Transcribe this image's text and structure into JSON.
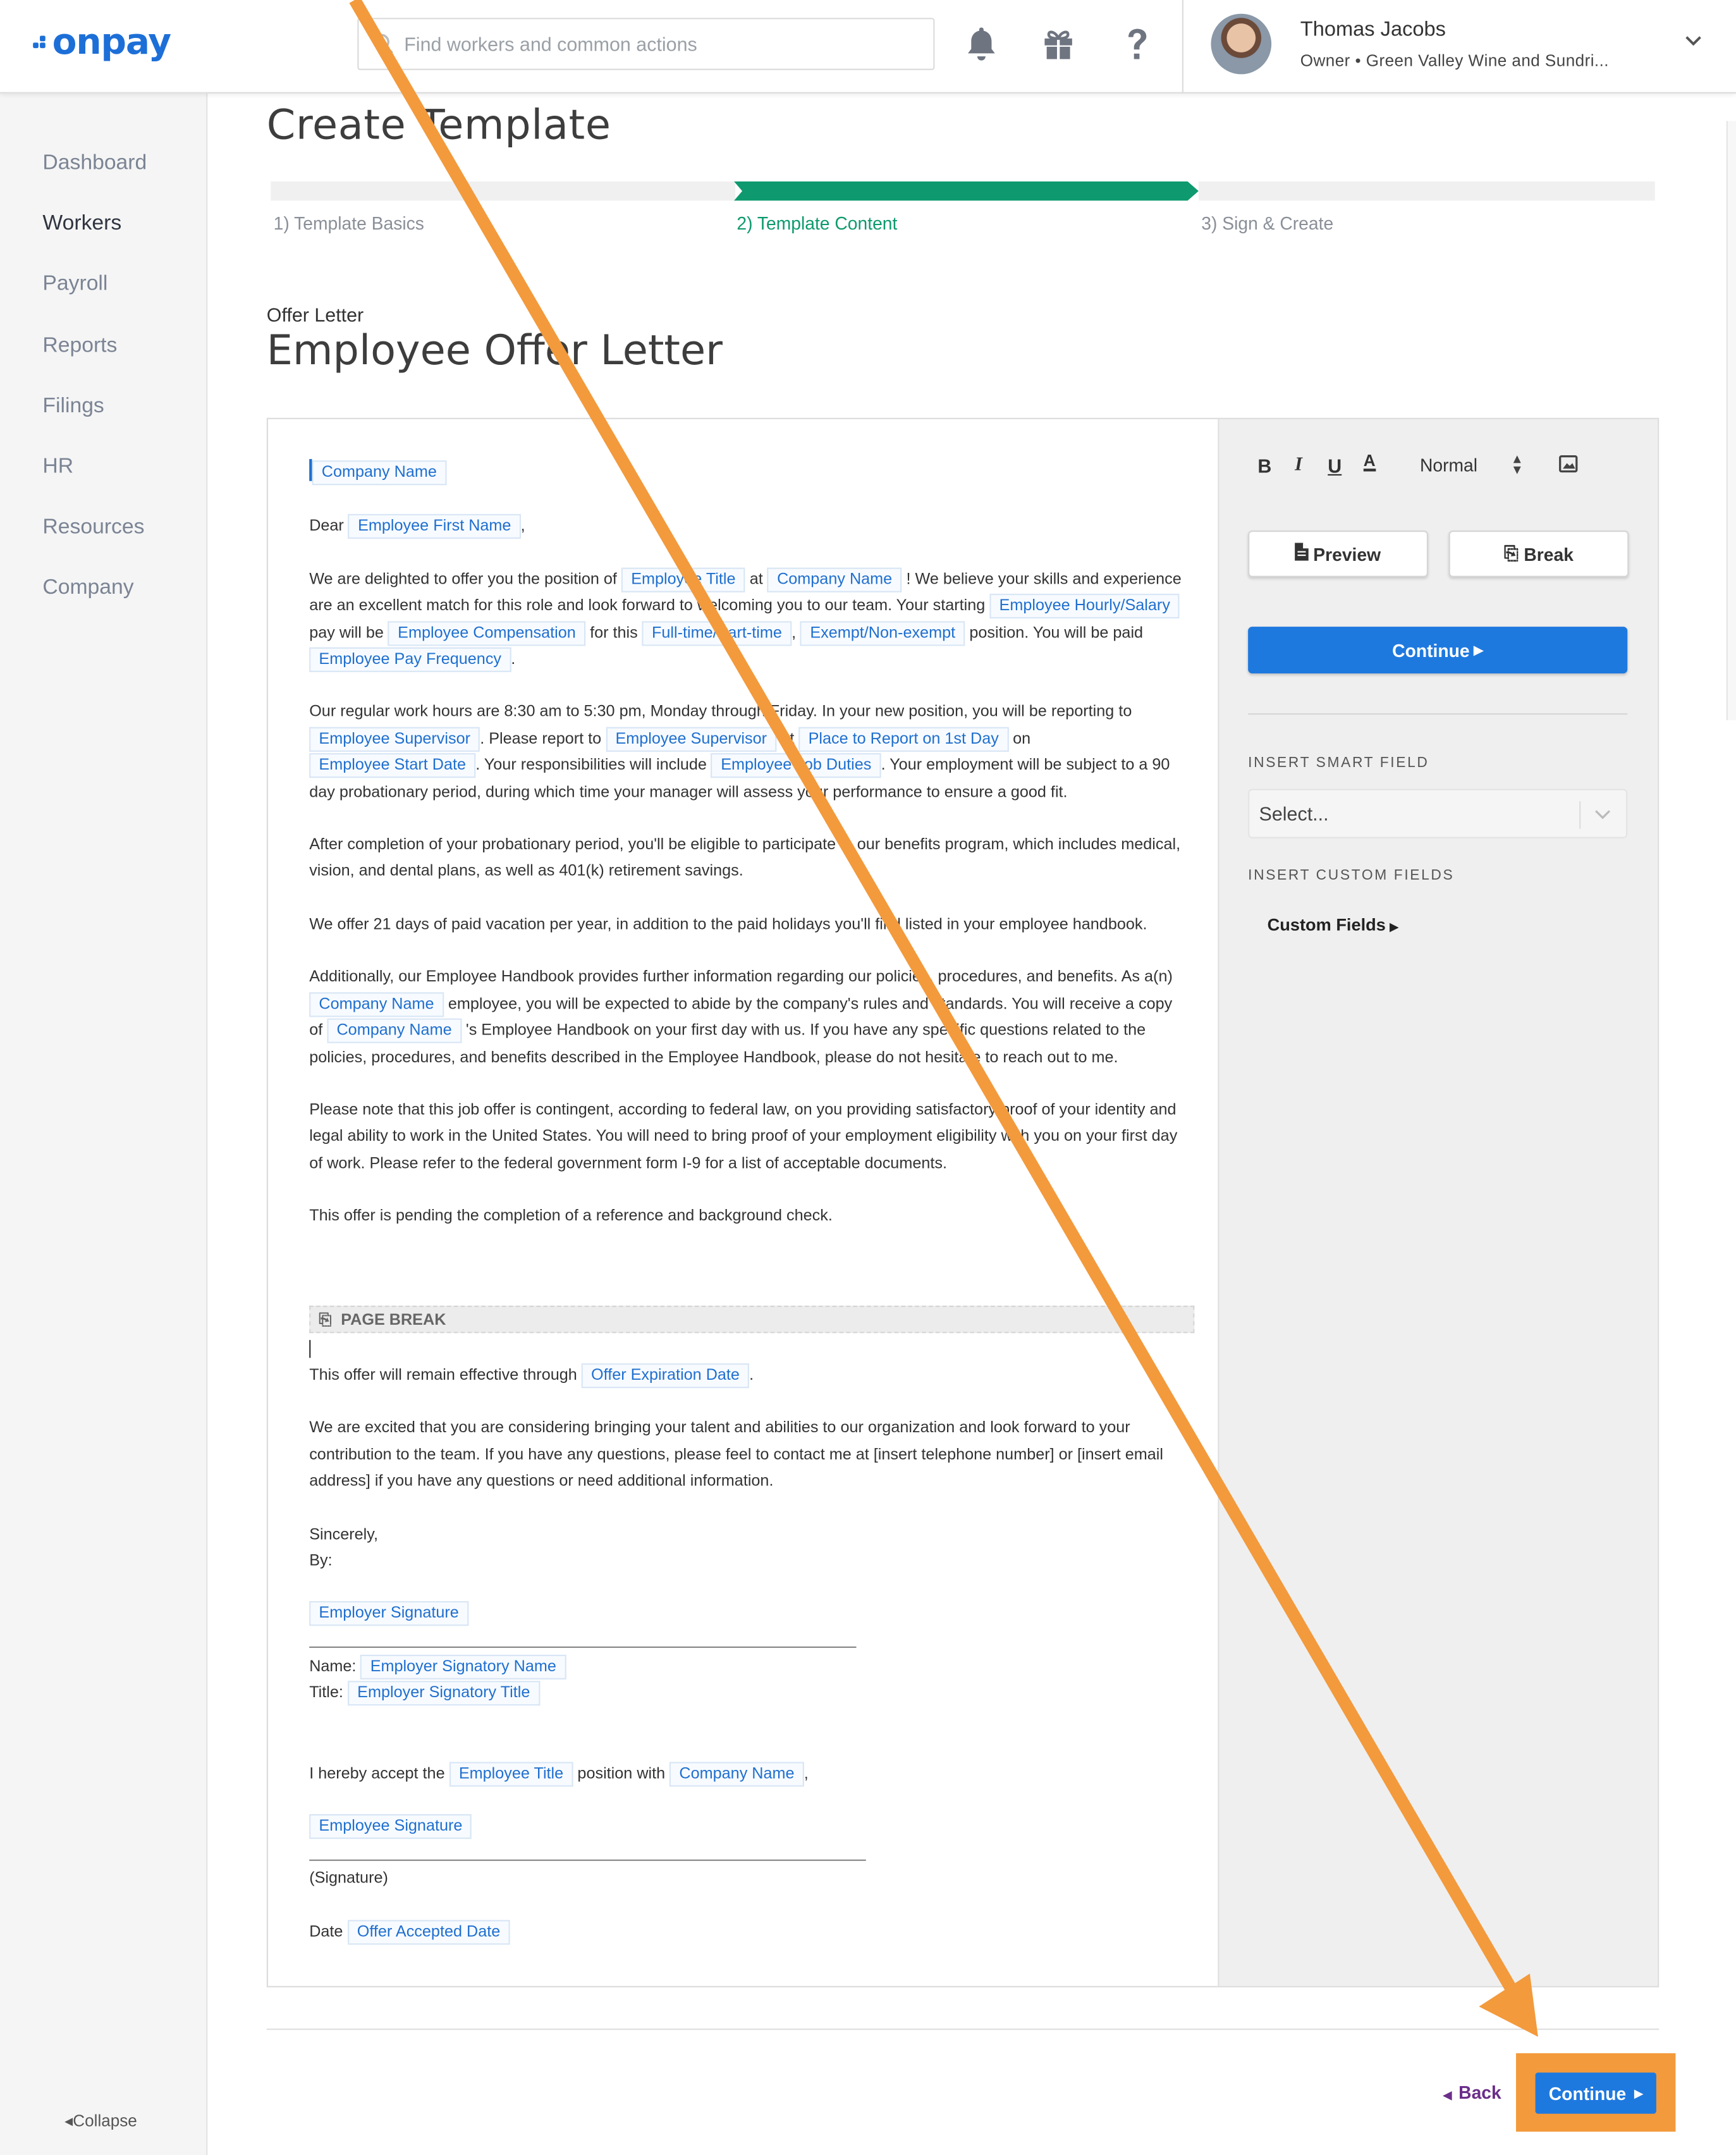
{
  "app": {
    "logo": "onpay",
    "brand_color": "#1d6fd8"
  },
  "header": {
    "search_placeholder": "Find workers and common actions",
    "user_name": "Thomas Jacobs",
    "user_role": "Owner • Green Valley Wine and Sundri..."
  },
  "sidebar": {
    "items": [
      {
        "label": "Dashboard"
      },
      {
        "label": "Workers"
      },
      {
        "label": "Payroll"
      },
      {
        "label": "Reports"
      },
      {
        "label": "Filings"
      },
      {
        "label": "HR"
      },
      {
        "label": "Resources"
      },
      {
        "label": "Company"
      }
    ],
    "collapse_label": "Collapse"
  },
  "page": {
    "title": "Create Template",
    "steps": [
      {
        "label": "1) Template Basics"
      },
      {
        "label": "2) Template Content"
      },
      {
        "label": "3) Sign & Create"
      }
    ],
    "active_step_color": "#0e9a6e",
    "doc_type": "Offer Letter",
    "doc_title": "Employee Offer Letter"
  },
  "doc": {
    "company_name": "Company Name",
    "dear": "Dear",
    "f_first_name": "Employee First Name",
    "p1_a": "We are delighted to offer you the position of",
    "f_title": "Employee Title",
    "at": "at",
    "p1_b": "! We believe your skills and experience are an excellent match for this role and look forward to welcoming you to our team. Your starting",
    "f_hourly": "Employee Hourly/Salary",
    "p1_c": "pay will be",
    "f_comp": "Employee Compensation",
    "for_this": "for this",
    "f_ftpt": "Full-time/Part-time",
    "f_exempt": "Exempt/Non-exempt",
    "p1_d": "position. You will be paid",
    "f_freq": "Employee Pay Frequency",
    "p2_a": "Our regular work hours are 8:30 am to 5:30 pm, Monday through Friday. In your new position, you will be reporting to",
    "f_supervisor": "Employee Supervisor",
    "p2_b": ". Please report to",
    "f_supervisor2": "Employee Supervisor",
    "p2_at": "at",
    "f_place": "Place to Report on 1st Day",
    "on": "on",
    "f_start": "Employee Start Date",
    "p2_c": ". Your responsibilities will include",
    "f_duties": "Employee Job Duties",
    "p2_d": ". Your employment will be subject to a 90 day probationary period, during which time your manager will assess your performance to ensure a good fit.",
    "p3": "After completion of your probationary period, you'll be eligible to participate in our benefits program, which includes medical, vision, and dental plans, as well as 401(k) retirement savings.",
    "p4": "We offer 21 days of paid vacation per year, in addition to the paid holidays you'll find listed in your employee handbook.",
    "p5_a": "Additionally, our Employee Handbook provides further information regarding our policies, procedures, and benefits. As a(n)",
    "p5_b": "employee, you will be expected to abide by the company's rules and standards. You will receive a copy of",
    "p5_c": "'s Employee Handbook on your first day with us. If you have any specific questions related to the policies, procedures, and benefits described in the Employee Handbook, please do not hesitate to reach out to me.",
    "p6": "Please note that this job offer is contingent, according to federal law, on you providing satisfactory proof of your identity and legal ability to work in the United States. You will need to bring proof of your employment eligibility with you on your first day of work. Please refer to the federal government form I-9 for a list of acceptable documents.",
    "p7": "This offer is pending the completion of a reference and background check.",
    "page_break": "PAGE BREAK",
    "p8_a": "This offer will remain effective through",
    "f_expiration": "Offer Expiration Date",
    "p9": "We are excited that you are considering bringing your talent and abilities to our organization and look forward to your contribution to the team. If you have any questions, please feel to contact me at [insert telephone number] or [insert email address] if you have any questions or need additional information.",
    "sincerely": "Sincerely,",
    "by": "By:",
    "f_employer_sig": "Employer Signature",
    "name_label": "Name:",
    "f_signatory_name": "Employer Signatory Name",
    "title_label": "Title:",
    "f_signatory_title": "Employer Signatory Title",
    "accept_a": "I hereby accept the",
    "accept_b": "position with",
    "f_employee_sig": "Employee Signature",
    "signature_label": "(Signature)",
    "date_label": "Date",
    "f_accepted_date": "Offer Accepted Date"
  },
  "toolbar": {
    "bold": "B",
    "italic": "I",
    "underline": "U",
    "color": "A",
    "format_value": "Normal"
  },
  "panel": {
    "preview_label": "Preview",
    "break_label": "Break",
    "continue_label": "Continue",
    "smart_field_heading": "INSERT SMART FIELD",
    "smart_field_placeholder": "Select...",
    "custom_fields_heading": "INSERT CUSTOM FIELDS",
    "custom_fields_label": "Custom Fields"
  },
  "footer": {
    "back_label": "Back",
    "continue_label": "Continue"
  },
  "annotation": {
    "color": "#f39a3c"
  }
}
